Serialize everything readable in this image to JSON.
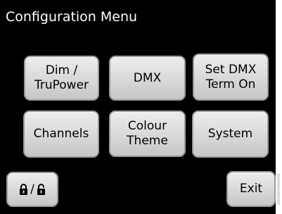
{
  "screen": {
    "title": "Configuration Menu",
    "background_color": "#000000",
    "button_color": "#d8d8d8"
  },
  "menu": {
    "dim_truopower": [
      "Dim /",
      "TruPower"
    ],
    "dmx": "DMX",
    "set_dmx_term": [
      "Set DMX",
      "Term On"
    ],
    "channels": "Channels",
    "colour_theme": [
      "Colour",
      "Theme"
    ],
    "system": "System"
  },
  "footer": {
    "lock_separator": "/",
    "lock_icon": "lock-icon",
    "unlock_icon": "unlock-icon",
    "exit_label": "Exit"
  }
}
